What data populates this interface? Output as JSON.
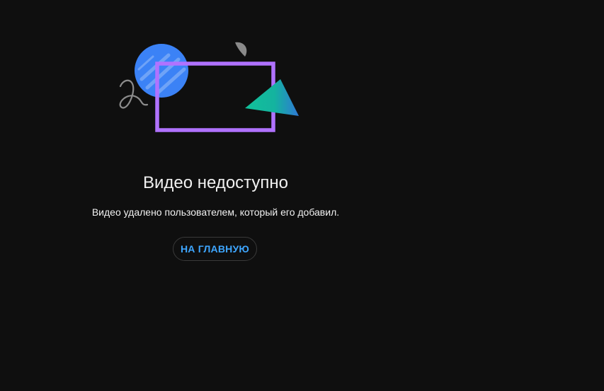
{
  "error": {
    "title": "Видео недоступно",
    "message": "Видео удалено пользователем, который его добавил.",
    "home_button_label": "НА ГЛАВНУЮ"
  },
  "colors": {
    "background": "#0f0f0f",
    "text": "#f1f1f1",
    "link_blue": "#3ea6ff",
    "circle_blue": "#3b82f6",
    "frame_purple": "#b072ff",
    "triangle_teal": "#12b99a",
    "leaf_gray": "#8a8a8a"
  },
  "illustration": {
    "icons": [
      "blue-circle-icon",
      "purple-frame-icon",
      "teal-triangle-icon",
      "gray-leaf-icon",
      "squiggle-icon"
    ]
  }
}
